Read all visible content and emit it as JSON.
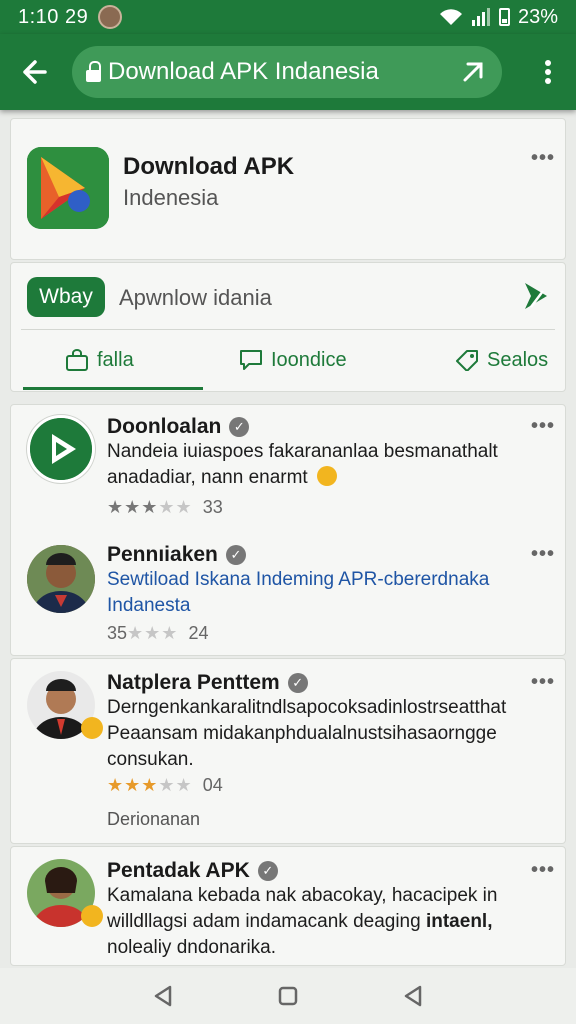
{
  "status_bar": {
    "time": "1:10 29",
    "battery": "23%"
  },
  "app_bar": {
    "url": "Download APK Indanesia"
  },
  "app_card": {
    "title": "Download APK",
    "subtitle": "Indenesia"
  },
  "search_card": {
    "chip_label": "Wbay",
    "query": "Apwnlow idania",
    "tabs": [
      {
        "label": "falla",
        "icon": "bag-icon"
      },
      {
        "label": "Ioondice",
        "icon": "chat-icon"
      },
      {
        "label": "Sealos",
        "icon": "tag-icon"
      }
    ]
  },
  "posts": [
    {
      "name": "Doonloalan",
      "body_lines": [
        "Nandeia iuiaspoes fakarananlaa besmanathalt",
        "anadadiar, nann enarmt"
      ],
      "stars": 3,
      "star_color": "gray",
      "count": "33"
    },
    {
      "name": "Pennıiaken",
      "body_lines": [
        "Sewtiload Iskana Indeming APR-cbererdnaka",
        "Indanesta"
      ],
      "rating_prefix": "35",
      "stars": 0,
      "count": "24"
    },
    {
      "name": "Natplera Penttem",
      "body_lines": [
        "Derngenkankaralitndlsapocoksadinlostrseatthat",
        "Peaansam midakanphdualalnustsihasaorngge",
        "consukan."
      ],
      "stars": 3,
      "star_color": "orange",
      "count": "04",
      "footer": "Derionanan"
    },
    {
      "name": "Pentadak APK",
      "body_lines": [
        "Kamalana kebada nak abacokay, hacacipek in",
        "willdllagsi adam indamacank deaging",
        "intaenl,",
        "nolealiy dndonarika."
      ]
    }
  ],
  "colors": {
    "brand_green": "#1e7a3a",
    "link_blue": "#1f55a5",
    "star_orange": "#e79a2a"
  }
}
